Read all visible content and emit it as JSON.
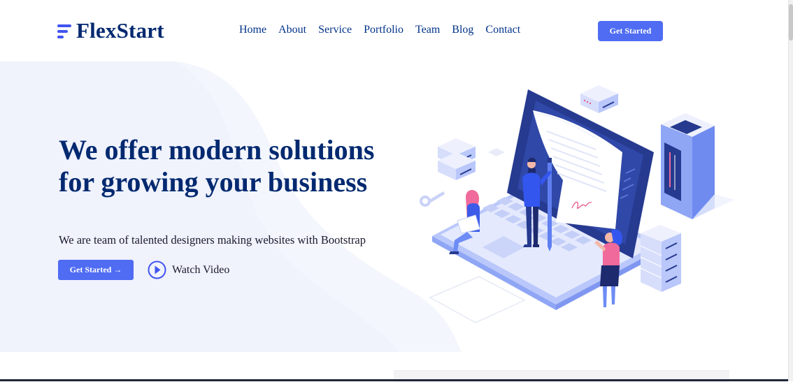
{
  "brand": {
    "name": "FlexStart",
    "icon": "logo-lines-icon",
    "accent": "#4154f1",
    "text_color": "#012970"
  },
  "nav": {
    "items": [
      {
        "label": "Home"
      },
      {
        "label": "About"
      },
      {
        "label": "Service"
      },
      {
        "label": "Portfolio"
      },
      {
        "label": "Team"
      },
      {
        "label": "Blog"
      },
      {
        "label": "Contact"
      }
    ],
    "cta_label": "Get Started"
  },
  "hero": {
    "title": "We offer modern solutions for growing your business",
    "subtitle": "We are team of  talented designers making websites with Bootstrap",
    "cta_label": "Get Started →",
    "watch_label": "Watch Video",
    "watch_icon": "play-circle-icon",
    "illustration": "isometric-laptop-team-illustration"
  },
  "colors": {
    "primary_button": "#4f6cf3",
    "hero_bg": "#f4f6fd"
  }
}
